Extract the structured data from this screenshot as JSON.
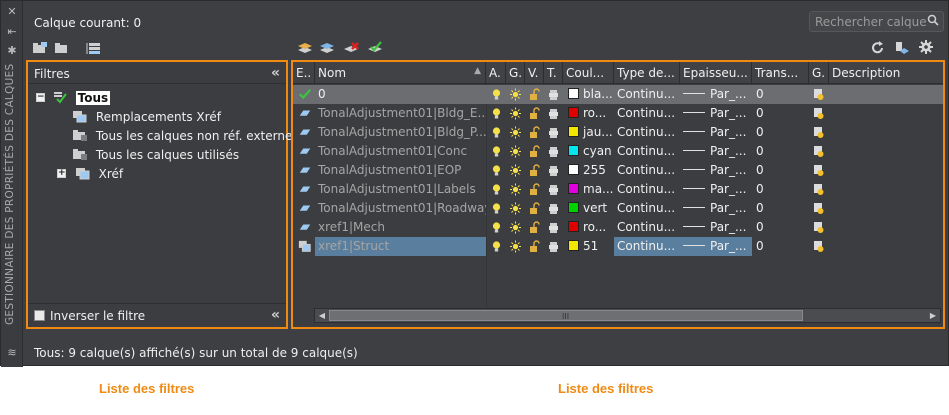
{
  "side_title": "GESTIONNAIRE DES PROPRIÉTÉS DES CALQUES",
  "current_layer": "Calque courant: 0",
  "search": {
    "placeholder": "Rechercher calque"
  },
  "filters": {
    "header": "Filtres",
    "tree": [
      {
        "label": "Tous",
        "expander": "−",
        "selected": true
      },
      {
        "label": "Remplacements Xréf"
      },
      {
        "label": "Tous les calques non réf. externes"
      },
      {
        "label": "Tous les calques utilisés"
      },
      {
        "label": "Xréf",
        "expander": "+"
      }
    ],
    "invert_label": "Inverser le filtre",
    "collapse_glyph": "«"
  },
  "grid": {
    "columns": [
      "E..",
      "Nom",
      "A.",
      "G.",
      "V.",
      "T.",
      "Coul...",
      "Type de...",
      "Epaisseu...",
      "Trans...",
      "G.",
      "Description"
    ],
    "rows": [
      {
        "status": "check",
        "name": "0",
        "color_name": "bla...",
        "color": "#ffffff",
        "linetype": "Continu...",
        "lineweight": "Par_...",
        "transparency": "0"
      },
      {
        "status": "layer",
        "name": "TonalAdjustment01|Bldg_E...",
        "color_name": "ro...",
        "color": "#e00000",
        "linetype": "Continu...",
        "lineweight": "Par_...",
        "transparency": "0"
      },
      {
        "status": "layer",
        "name": "TonalAdjustment01|Bldg_P...",
        "color_name": "jau...",
        "color": "#f2e600",
        "linetype": "Continu...",
        "lineweight": "Par_...",
        "transparency": "0"
      },
      {
        "status": "layer",
        "name": "TonalAdjustment01|Conc",
        "color_name": "cyan",
        "color": "#00e5ee",
        "linetype": "Continu...",
        "lineweight": "Par_...",
        "transparency": "0"
      },
      {
        "status": "layer",
        "name": "TonalAdjustment01|EOP",
        "color_name": "255",
        "color": "#ffffff",
        "linetype": "Continu...",
        "lineweight": "Par_...",
        "transparency": "0"
      },
      {
        "status": "layer",
        "name": "TonalAdjustment01|Labels",
        "color_name": "ma...",
        "color": "#e000e0",
        "linetype": "Continu...",
        "lineweight": "Par_...",
        "transparency": "0"
      },
      {
        "status": "layer",
        "name": "TonalAdjustment01|Roadway",
        "color_name": "vert",
        "color": "#00d200",
        "linetype": "Continu...",
        "lineweight": "Par_...",
        "transparency": "0"
      },
      {
        "status": "layer",
        "name": "xref1|Mech",
        "color_name": "ro...",
        "color": "#e00000",
        "linetype": "Continu...",
        "lineweight": "Par_...",
        "transparency": "0"
      },
      {
        "status": "xref",
        "name": "xref1|Struct",
        "color_name": "51",
        "color": "#f2e600",
        "linetype": "Continu...",
        "lineweight": "Par_...",
        "transparency": "0",
        "selected": true
      }
    ],
    "scroll_grip": "III"
  },
  "status_text": "Tous: 9 calque(s) affiché(s) sur un total de 9 calque(s)",
  "captions": {
    "left": "Liste des filtres",
    "right": "Liste des filtres"
  },
  "colors": {
    "accent": "#f08a12",
    "panel": "#3b3d40",
    "selection": "#5a7e9d"
  }
}
